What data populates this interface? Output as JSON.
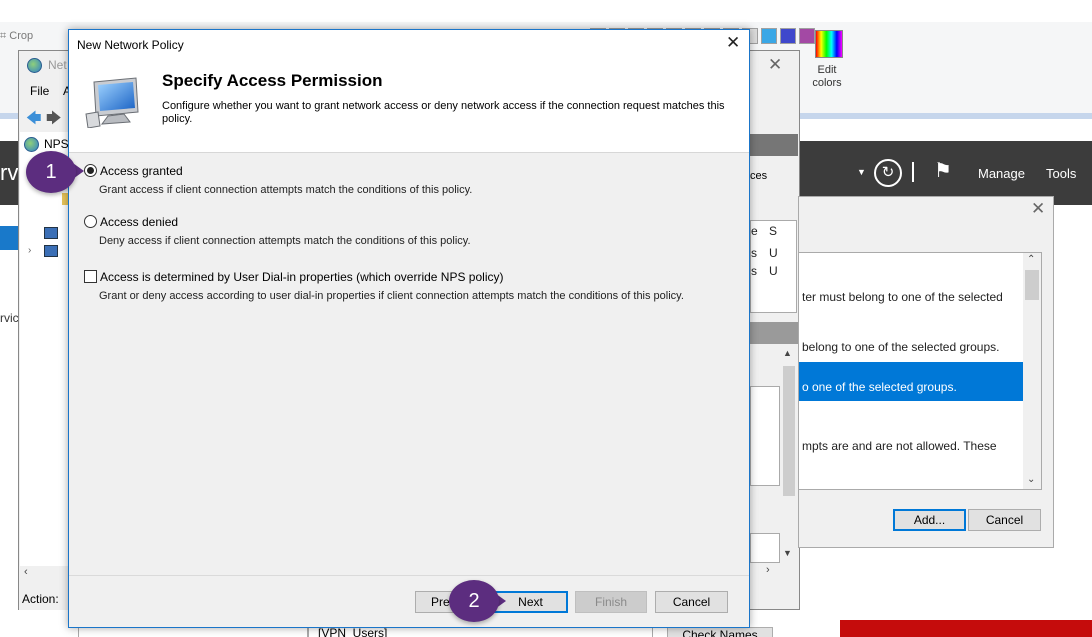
{
  "paint": {
    "crop_label": "Crop",
    "edit_colors_line1": "Edit",
    "edit_colors_line2": "colors",
    "swatches": [
      "#c8c8c8",
      "#d8d8d8",
      "#d0d0d0",
      "#e0e0e0",
      "#d4d4d4",
      "#cccccc",
      "#d8d8d8",
      "#e4e4e4",
      "#dcdcdc",
      "#3aa7e6",
      "#3f48cc",
      "#a349a4"
    ]
  },
  "server_manager": {
    "left_text": "rve",
    "manage_label": "Manage",
    "tools_label": "Tools",
    "side_text": "rvic"
  },
  "nps_console": {
    "title": "Net",
    "menu_file": "File",
    "menu_action": "A",
    "tree_root": "NPS",
    "status_action": "Action:",
    "right_header_text": "ces",
    "right_cols": [
      "e",
      "s",
      "s"
    ],
    "right_cols2": [
      "S",
      "U",
      "U"
    ]
  },
  "group_dialog": {
    "items": [
      "ter must belong to one of the selected",
      "belong to one of the selected groups.",
      "o one of the selected groups.",
      "mpts are and are not allowed. These"
    ],
    "add_button": "Add...",
    "cancel_button": "Cancel"
  },
  "bottom": {
    "vpn_users": "[VPN_Users]",
    "check_names": "Check Names"
  },
  "dialog": {
    "title": "New Network Policy",
    "header_title": "Specify Access Permission",
    "header_description": "Configure whether you want to grant network access or deny network access if the connection request matches this policy.",
    "options": {
      "granted_label": "Access granted",
      "granted_desc": "Grant access if client connection attempts match the conditions of this policy.",
      "denied_label": "Access denied",
      "denied_desc": "Deny access if client connection attempts match the conditions of this policy.",
      "dialin_label": "Access is determined by User Dial-in properties (which override NPS policy)",
      "dialin_desc": "Grant or deny access according to user dial-in properties if client connection attempts match the conditions of this policy."
    },
    "selected_option": "Access granted",
    "buttons": {
      "previous": "Previous",
      "previous_visible": "Prev",
      "next": "Next",
      "finish": "Finish",
      "cancel": "Cancel"
    }
  },
  "callouts": {
    "step1": "1",
    "step2": "2",
    "color": "#5c2d7f"
  }
}
